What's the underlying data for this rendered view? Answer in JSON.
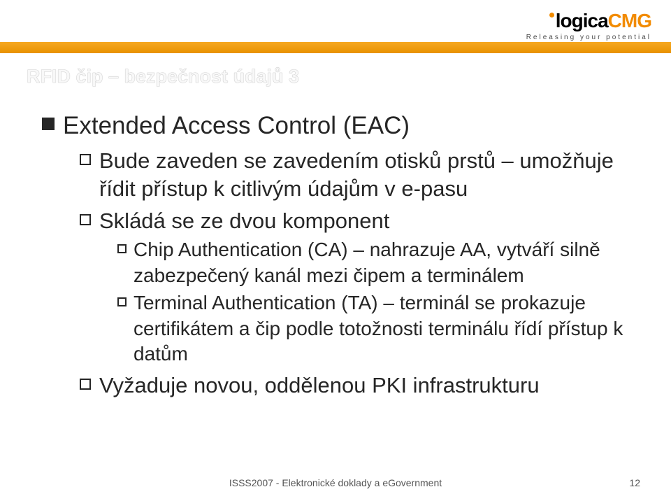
{
  "brand": {
    "logo_black": "logica",
    "logo_orange": "CMG",
    "tagline": "Releasing your potential"
  },
  "title": "RFID čip – bezpečnost údajů 3",
  "body": {
    "l1": "Extended Access Control (EAC)",
    "l2a": "Bude zaveden se zavedením otisků prstů – umožňuje řídit přístup k citlivým údajům v e-pasu",
    "l2b": "Skládá se ze dvou komponent",
    "l3a": "Chip Authentication (CA) – nahrazuje AA, vytváří silně zabezpečený kanál mezi čipem a terminálem",
    "l3b": "Terminal Authentication (TA) – terminál se prokazuje certifikátem a čip podle totožnosti terminálu řídí přístup k datům",
    "l2c": "Vyžaduje novou, oddělenou PKI infrastrukturu"
  },
  "footer": {
    "text": "ISSS2007 - Elektronické doklady a eGovernment",
    "page": "12"
  }
}
